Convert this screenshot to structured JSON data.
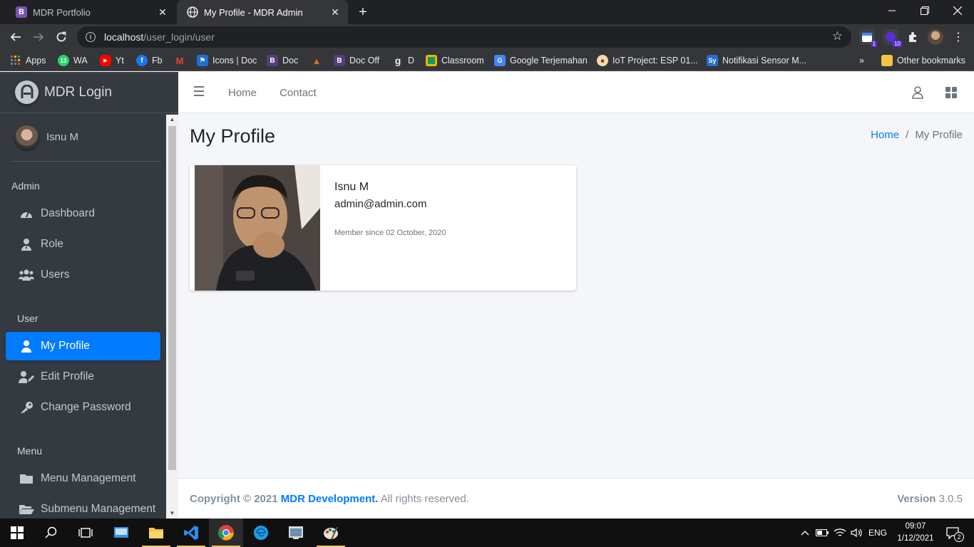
{
  "browser": {
    "tabs": [
      {
        "title": "MDR Portfolio",
        "favicon": "bootstrap-icon"
      },
      {
        "title": "My Profile - MDR Admin",
        "favicon": "globe-icon"
      }
    ],
    "url_host": "localhost",
    "url_path": "/user_login/user",
    "extension_badges": [
      "1",
      "10"
    ],
    "bookmarks": [
      {
        "label": "Apps",
        "icon": "apps-grid-icon"
      },
      {
        "label": "WA",
        "icon": "whatsapp-icon",
        "badge": "13"
      },
      {
        "label": "Yt",
        "icon": "youtube-icon"
      },
      {
        "label": "Fb",
        "icon": "facebook-icon"
      },
      {
        "label": "",
        "icon": "gmail-icon"
      },
      {
        "label": "Icons | Doc",
        "icon": "flag-icon"
      },
      {
        "label": "Doc",
        "icon": "bootstrap-icon"
      },
      {
        "label": "",
        "icon": "codeigniter-icon"
      },
      {
        "label": "Doc Off",
        "icon": "bootstrap-icon"
      },
      {
        "label": "D",
        "icon": "g-icon"
      },
      {
        "label": "Classroom",
        "icon": "classroom-icon"
      },
      {
        "label": "Google Terjemahan",
        "icon": "translate-icon"
      },
      {
        "label": "IoT Project: ESP 01...",
        "icon": "iot-icon"
      },
      {
        "label": "Notifikasi Sensor M...",
        "icon": "sy-icon"
      }
    ],
    "bookmarks_overflow": "»",
    "other_bookmarks": "Other bookmarks"
  },
  "sidebar": {
    "brand": "MDR Login",
    "user_name": "Isnu M",
    "sections": [
      {
        "header": "Admin",
        "items": [
          {
            "label": "Dashboard",
            "icon": "tachometer-icon"
          },
          {
            "label": "Role",
            "icon": "user-tie-icon"
          },
          {
            "label": "Users",
            "icon": "users-icon"
          }
        ]
      },
      {
        "header": "User",
        "items": [
          {
            "label": "My Profile",
            "icon": "user-icon",
            "active": true
          },
          {
            "label": "Edit Profile",
            "icon": "user-edit-icon"
          },
          {
            "label": "Change Password",
            "icon": "key-icon"
          }
        ]
      },
      {
        "header": "Menu",
        "items": [
          {
            "label": "Menu Management",
            "icon": "folder-icon"
          },
          {
            "label": "Submenu Management",
            "icon": "folder-open-icon"
          }
        ]
      }
    ]
  },
  "topnav": {
    "links": [
      "Home",
      "Contact"
    ]
  },
  "content": {
    "title": "My Profile",
    "breadcrumb": [
      "Home",
      "My Profile"
    ],
    "profile": {
      "name": "Isnu M",
      "email": "admin@admin.com",
      "member_since": "Member since 02 October, 2020"
    }
  },
  "footer": {
    "copyright_prefix": "Copyright © 2021 ",
    "copyright_brand": "MDR Development.",
    "copyright_suffix": " All rights reserved.",
    "version_label": "Version",
    "version_value": "3.0.5"
  },
  "taskbar": {
    "language": "ENG",
    "time": "09:07",
    "date": "1/12/2021",
    "notification_count": "2"
  },
  "colors": {
    "sidebar_bg": "#343a40",
    "active_item": "#007bff",
    "link": "#007bff",
    "content_bg": "#f4f6f9"
  }
}
